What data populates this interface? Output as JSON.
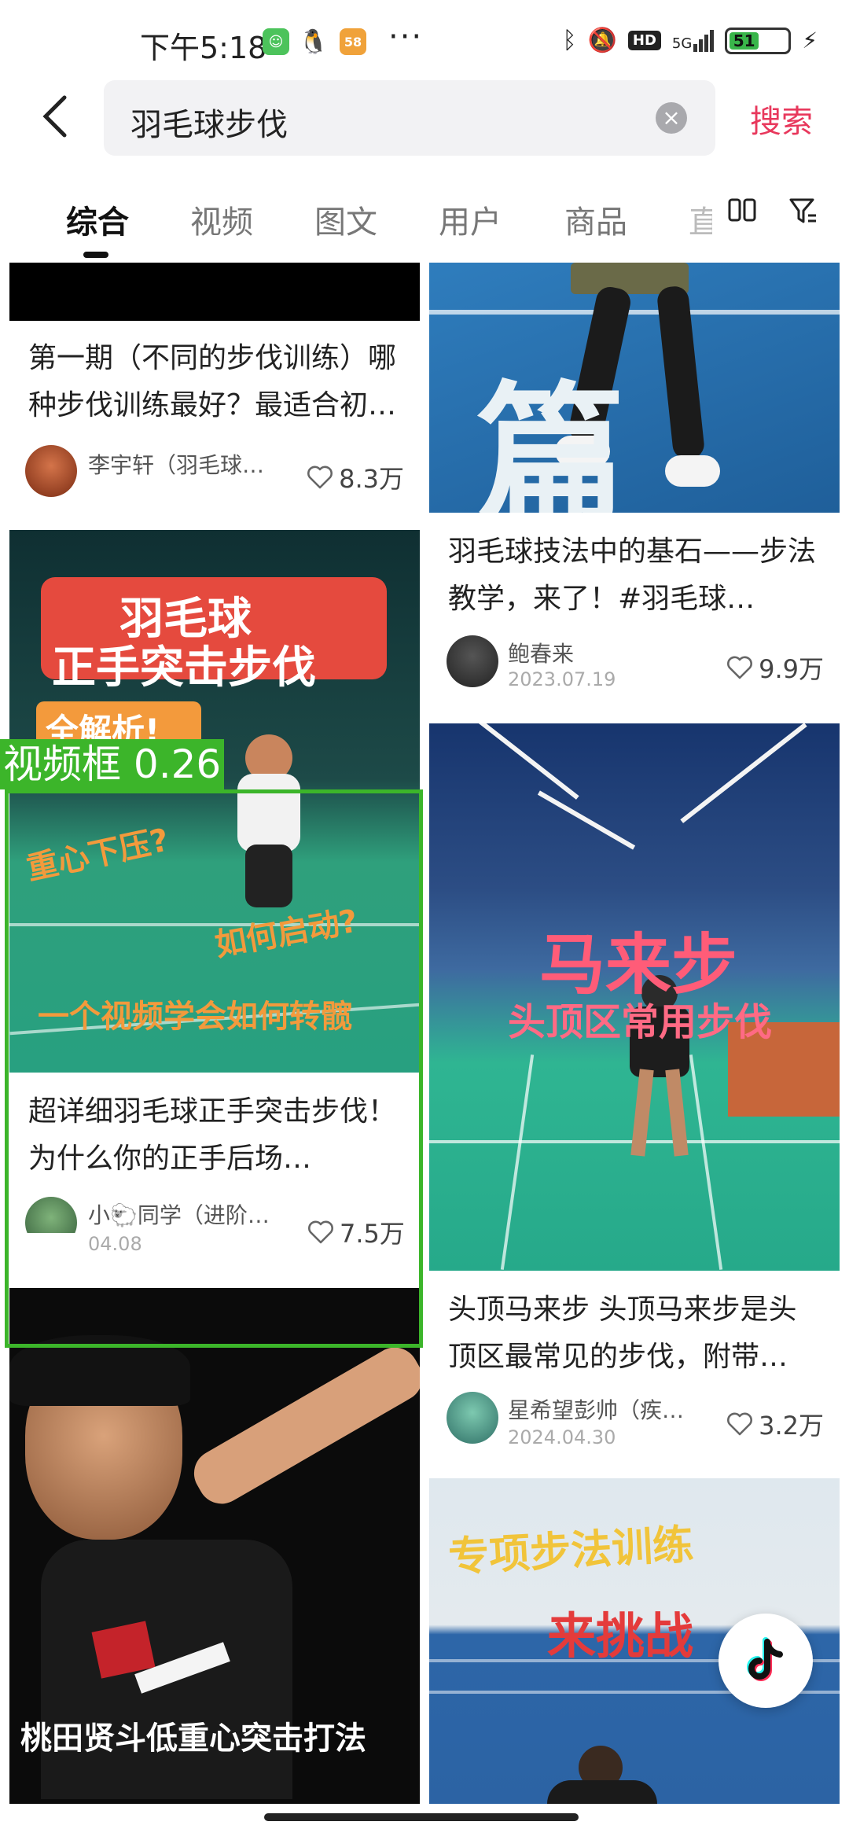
{
  "status": {
    "time": "下午5:18",
    "more": "···",
    "net": "5G",
    "battery": "51"
  },
  "search": {
    "query": "羽毛球步伐",
    "button": "搜索"
  },
  "tabs": [
    "综合",
    "视频",
    "图文",
    "用户",
    "商品",
    "直"
  ],
  "detection": {
    "label": "视频框 0.26"
  },
  "cards": {
    "c1": {
      "title": "第一期（不同的步伐训练）哪种步伐训练最好？最适合初学者的步伐训练",
      "author": "李宇轩（羽毛球…",
      "likes": "8.3万"
    },
    "c2": {
      "title": "羽毛球技法中的基石——步法教学，来了！#羽毛球…",
      "author": "鲍春来",
      "date": "2023.07.19",
      "likes": "9.9万",
      "overlay": "篇"
    },
    "c3": {
      "title": "超详细羽毛球正手突击步伐！ 为什么你的正手后场…",
      "author": "小🐑同学（进阶…",
      "date": "04.08",
      "likes": "7.5万",
      "overlay": [
        "羽毛球",
        "正手突击步伐",
        "全解析!",
        "重心下压?",
        "如何启动?",
        "一个视频学会如何转髋"
      ]
    },
    "c4": {
      "title": "头顶马来步 头顶马来步是头顶区最常见的步伐，附带…",
      "author": "星希望彭帅（疾…",
      "date": "2024.04.30",
      "likes": "3.2万",
      "overlay": [
        "马来步",
        "头顶区常用步伐"
      ]
    },
    "c5": {
      "overlay": "桃田贤斗低重心突击打法"
    },
    "c6": {
      "overlay": [
        "专项步法训练",
        "来挑战"
      ]
    }
  },
  "colors": {
    "accent": "#e8385c",
    "detect": "#3cb52a",
    "court": "#1fa58a"
  }
}
